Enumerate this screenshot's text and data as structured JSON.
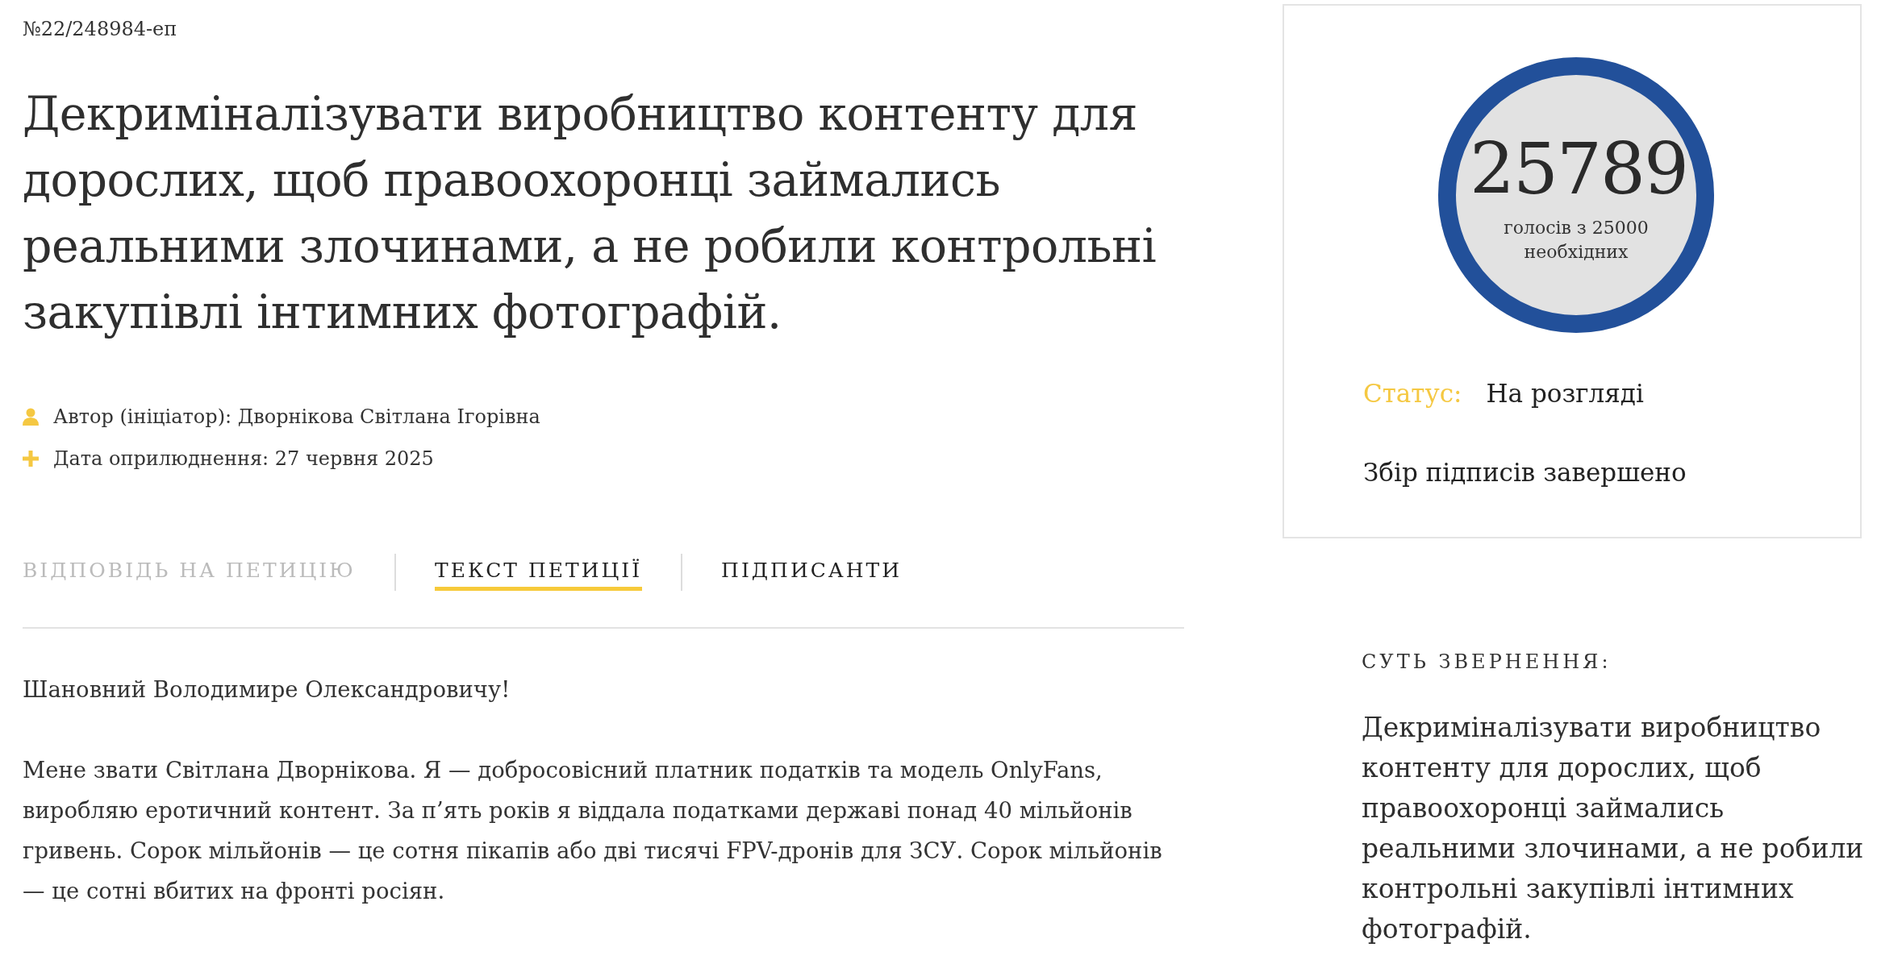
{
  "petition": {
    "number": "№22/248984-еп",
    "title": "Декриміналізувати виробництво контенту для дорослих, щоб правоохоронці займались реальними злочинами, а не робили контрольні закупівлі інтимних фотографій.",
    "meta": [
      {
        "kind": "author",
        "text": "Автор (ініціатор): Дворнікова Світлана Ігорівна"
      },
      {
        "kind": "date",
        "text": "Дата оприлюднення: 27 червня 2025"
      }
    ]
  },
  "tabs": [
    {
      "label": "ВІДПОВІДЬ НА ПЕТИЦІЮ",
      "selected": false,
      "disabled": true
    },
    {
      "label": "ТЕКСТ ПЕТИЦІЇ",
      "selected": true,
      "disabled": false
    },
    {
      "label": "ПІДПИСАНТИ",
      "selected": false,
      "disabled": false
    }
  ],
  "body": [
    "Шановний Володимире Олександровичу!",
    "Мене звати Світлана Дворнікова. Я — добросовісний платник податків та модель OnlyFans, виробляю еротичний контент. За п’ять років я віддала податками державі понад 40 мільйонів гривень. Сорок мільйонів — це сотня пікапів або дві тисячі FPV-дронів для ЗСУ. Сорок мільйонів — це сотні вбитих на фронті росіян."
  ],
  "votes": {
    "count": "25789",
    "caption": "голосів з 25000 необхідних",
    "level": 1
  },
  "status": {
    "label": "Статус:",
    "value": "На розгляді",
    "note": "Збір підписів завершено"
  },
  "summary": {
    "heading": "СУТЬ ЗВЕРНЕННЯ:",
    "text": "Декриміналізувати виробництво контенту для дорослих, щоб правоохоронці займались реальними злочинами, а не робили контрольні закупівлі інтимних фотографій."
  }
}
